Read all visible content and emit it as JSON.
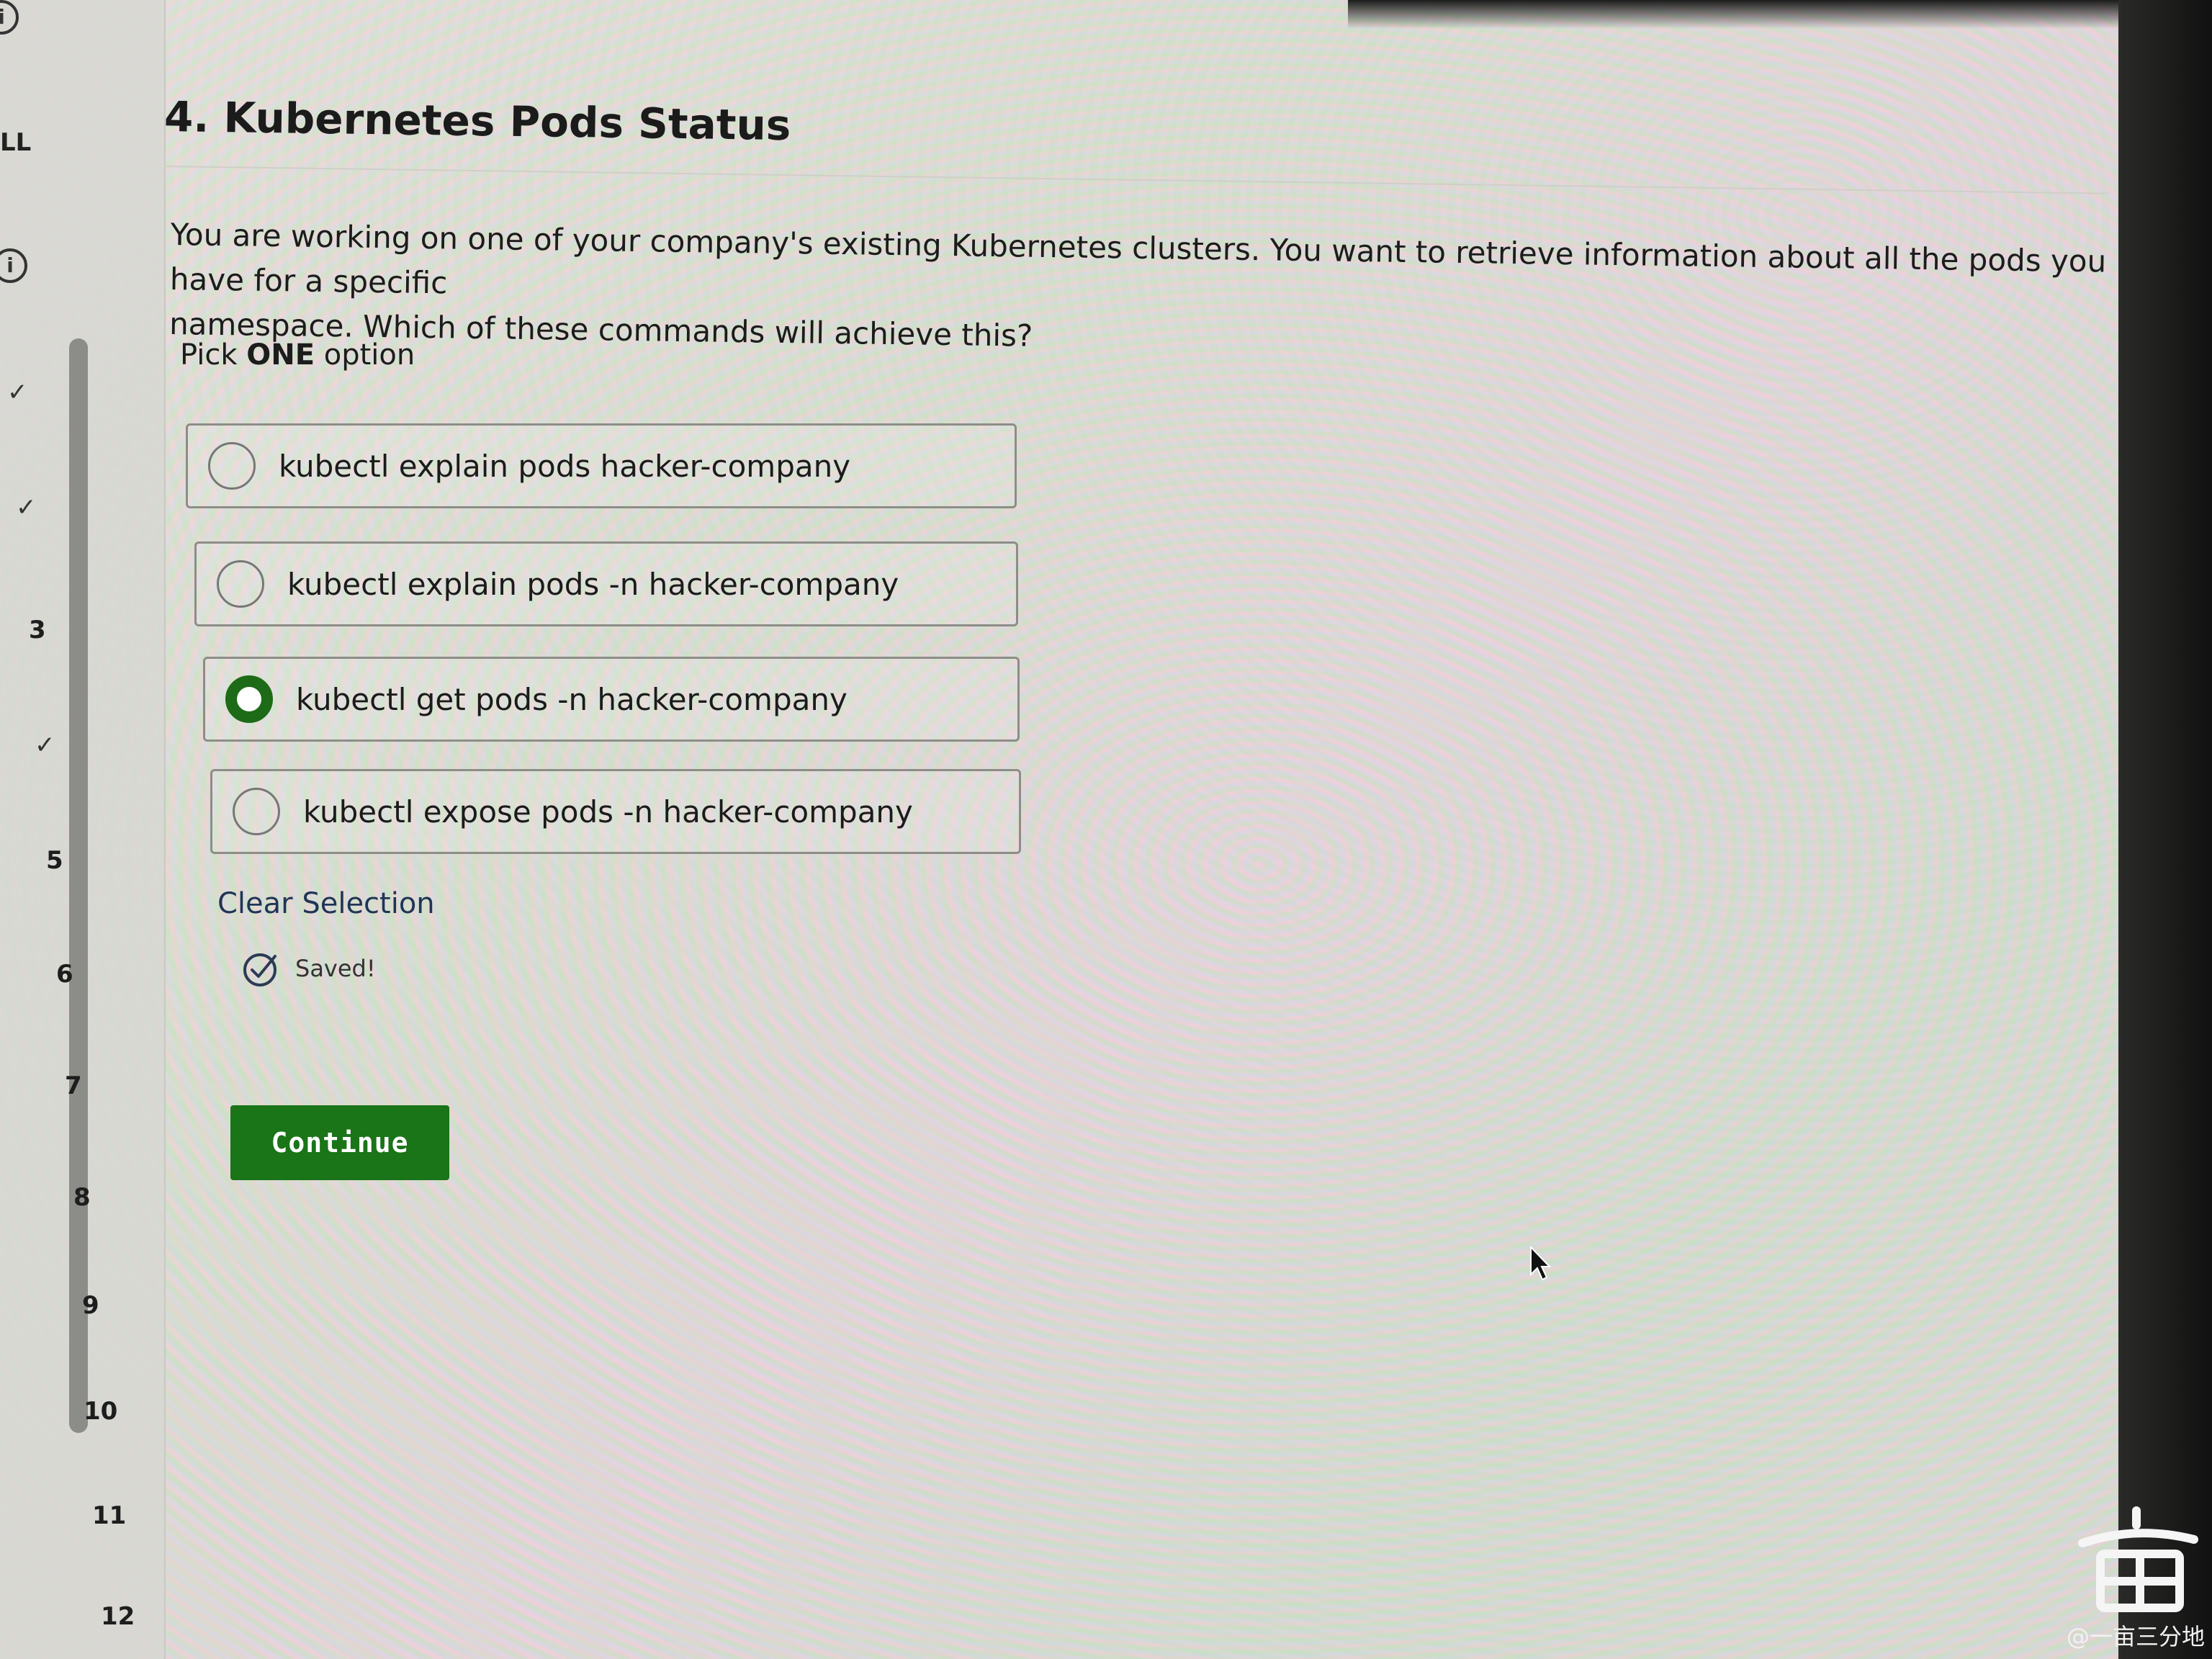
{
  "sidebar": {
    "top_label": "LL",
    "questions": [
      {
        "label": "✓",
        "status": "answered"
      },
      {
        "label": "✓",
        "status": "answered"
      },
      {
        "label": "3",
        "status": "unanswered"
      },
      {
        "label": "✓",
        "status": "answered"
      },
      {
        "label": "5",
        "status": "unanswered"
      },
      {
        "label": "6",
        "status": "unanswered"
      },
      {
        "label": "7",
        "status": "unanswered"
      },
      {
        "label": "8",
        "status": "unanswered"
      },
      {
        "label": "9",
        "status": "unanswered"
      },
      {
        "label": "10",
        "status": "unanswered"
      },
      {
        "label": "11",
        "status": "unanswered"
      },
      {
        "label": "12",
        "status": "unanswered"
      }
    ]
  },
  "question": {
    "title": "4. Kubernetes Pods Status",
    "line1": "You are working on one of your company's existing Kubernetes clusters.  You want to retrieve information about all the pods you have for a specific",
    "line2": "namespace. Which of these commands will achieve this?",
    "pick_prefix": "Pick ",
    "pick_bold": "ONE",
    "pick_suffix": " option"
  },
  "options": [
    {
      "label": "kubectl explain pods hacker-company",
      "selected": false
    },
    {
      "label": "kubectl explain pods -n hacker-company",
      "selected": false
    },
    {
      "label": "kubectl get pods -n hacker-company",
      "selected": true
    },
    {
      "label": "kubectl expose pods -n hacker-company",
      "selected": false
    }
  ],
  "clear_label": "Clear Selection",
  "saved_label": "Saved!",
  "continue_label": "Continue",
  "watermark": "@一亩三分地",
  "colors": {
    "accent": "#1a7418",
    "link": "#1f3555"
  }
}
